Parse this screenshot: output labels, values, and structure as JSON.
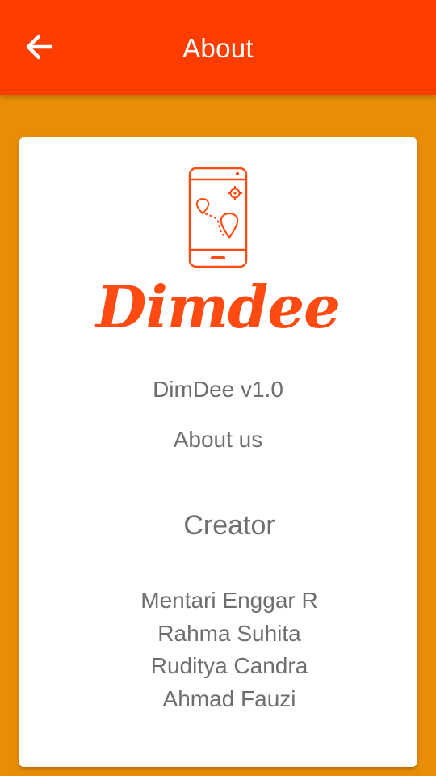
{
  "appbar": {
    "title": "About",
    "background": "#FF3D00",
    "back_icon": "arrow-left-icon"
  },
  "page": {
    "background": "#E98D08"
  },
  "card": {
    "logo_icon": "phone-map-icon",
    "brand": "Dimdee",
    "brand_color": "#FF4B12",
    "version": "DimDee v1.0",
    "about_link": "About us",
    "creator_heading": "Creator",
    "creators": [
      "Mentari Enggar R",
      "Rahma Suhita",
      "Ruditya Candra",
      "Ahmad Fauzi"
    ]
  }
}
